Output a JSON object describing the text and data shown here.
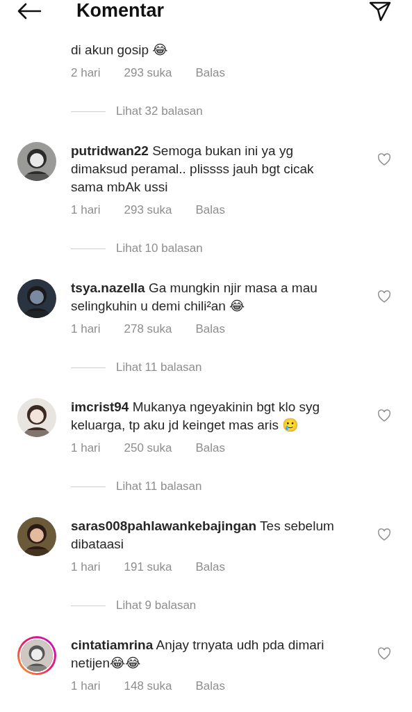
{
  "header": {
    "title": "Komentar"
  },
  "comments": [
    {
      "kind": "cut",
      "text": "di akun gosip 😂",
      "time": "2 hari",
      "likes": "293 suka",
      "reply": "Balas",
      "replies": "Lihat 32 balasan"
    },
    {
      "kind": "full",
      "story": false,
      "text": "**putridwan22** Semoga bukan ini ya yg dimaksud peramal.. plissss jauh bgt cicak sama mbAk ussi",
      "time": "1 hari",
      "likes": "293 suka",
      "reply": "Balas",
      "replies": "Lihat 10 balasan"
    },
    {
      "kind": "full",
      "story": false,
      "text": "**tsya.nazella** Ga mungkin njir masa a mau selingkuhin u demi chili²an 😂",
      "time": "1 hari",
      "likes": "278 suka",
      "reply": "Balas",
      "replies": "Lihat 11 balasan"
    },
    {
      "kind": "full",
      "story": false,
      "text": "**imcrist94** Mukanya ngeyakinin bgt klo syg keluarga, tp aku jd keinget mas aris 🥲",
      "time": "1 hari",
      "likes": "250 suka",
      "reply": "Balas",
      "replies": "Lihat 11 balasan"
    },
    {
      "kind": "full",
      "story": false,
      "text": "**saras008pahlawankebajingan** Tes sebelum dibataasi",
      "time": "1 hari",
      "likes": "191 suka",
      "reply": "Balas",
      "replies": "Lihat 9 balasan"
    },
    {
      "kind": "full",
      "story": true,
      "text": "**cintatiamrina** Anjay trnyata udh pda dimari netijen😂😂",
      "time": "1 hari",
      "likes": "148 suka",
      "reply": "Balas"
    }
  ]
}
